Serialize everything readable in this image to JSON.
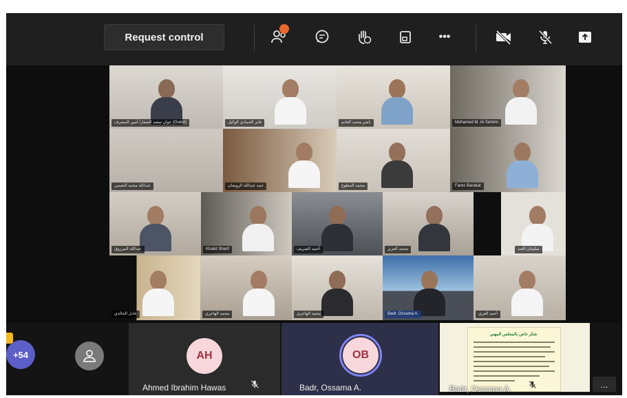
{
  "toolbar": {
    "request_control_label": "Request control",
    "icons": [
      "people-icon",
      "chat-icon",
      "react-icon",
      "share-tray-icon",
      "more-actions-icon",
      "camera-off-icon",
      "mic-off-icon",
      "share-screen-icon"
    ],
    "more_label": "•••",
    "participants_badge_color": "#e9692c"
  },
  "grid": {
    "name_labels": [
      "ﻋﻮﺍﻥ ﺳﻌﻴﺪ ﺍﻟﺼﻔﺎﺭ/ ﺃﻣﻴﻦ ﺍﻟﻤﺼﺮﻑ (Guest)",
      "ﻓﺎﻳﺰ ﺍﻟﺤﻤﺎﺩﻱ ﺍﻟﻮﻛﻴﻞ",
      "ﻧﺎﺻﺮ ﻣﺤﻤﺪ ﺍﻟﻐﺎﻧﻢ",
      "Mohamed M. Al-Tamimi",
      "ﻋﺒﺪﺍﻟﻠﻪ ﻣﺤﻤﺪ ﺍﻟﻨﻌﻴﻤﻲ",
      "ﺣﻤﺪ ﻋﺒﺪﺍﻟﻠﻪ ﺍﻟﺮﻭﺿﺎﻥ",
      "ﻣﺤﻤﺪ ﺍﻟﻤﻄﻮﻉ",
      "Fares Barakat",
      "ﻋﺒﺪﺍﻟﻠﻪ ﺍﻟﻤﺮﺯﻭﻕ",
      "Khalid Sharif",
      "ﺃﺣﻤﺪ ﺍﻟﺸﺮﻳﻒ",
      "ﻣﺤﻤﺪ ﺍﻟﻌﺰﻳﺰ",
      "ﺳﻠﻴﻤﺎﻥ ﺍﻟﻌﺒﺪ",
      "ﻋﺎﺩﻝ ﺍﻟﺨﺎﻟﺪﻱ",
      "ﻣﺤﻤﺪ ﺍﻟﻬﺎﺟﺮﻱ",
      "ﻣﺤﻤﺪ ﺍﻟﻬﺎﺟﺮﻱ",
      "Badr, Ossama A.",
      "ﺃﺣﻤﺪ ﺍﻟﻌﺰﻱ"
    ]
  },
  "strip": {
    "overflow_count": "+54",
    "participants": [
      {
        "initials": "AH",
        "name": "Ahmed Ibrahim Hawas",
        "muted": true,
        "avatar_bg": "#f7d7db",
        "avatar_fg": "#a0303e"
      },
      {
        "initials": "OB",
        "name": "Badr, Ossama A.",
        "muted": false,
        "avatar_bg": "#f7d7db",
        "avatar_fg": "#a0303e"
      },
      {
        "name": "Badr, Ossama A.",
        "muted": true
      }
    ],
    "document_title": "ﺷﻜﺮ ﺧﺎﺹ ﺑﺎﻟﻤﺠﻠﺲ ﺍﻟﻤﻬﻨﻲ",
    "more_label": "..."
  }
}
